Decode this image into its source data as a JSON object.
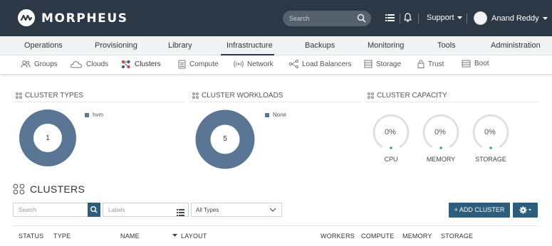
{
  "brand": {
    "name": "MORPHEUS"
  },
  "topbar": {
    "search_placeholder": "Search",
    "support_label": "Support",
    "user_name": "Anand Reddy",
    "icons": [
      "list-icon",
      "bell-icon",
      "search-icon",
      "caret-down-icon"
    ]
  },
  "main_nav": {
    "items": [
      "Operations",
      "Provisioning",
      "Library",
      "Infrastructure",
      "Backups",
      "Monitoring",
      "Tools",
      "Administration"
    ],
    "active": "Infrastructure"
  },
  "sub_nav": {
    "items": [
      "Groups",
      "Clouds",
      "Clusters",
      "Compute",
      "Network",
      "Load Balancers",
      "Storage",
      "Trust",
      "Boot"
    ],
    "active": "Clusters"
  },
  "widgets": {
    "cluster_types": {
      "title": "CLUSTER TYPES",
      "legend": "hvm",
      "center": "1"
    },
    "cluster_workloads": {
      "title": "CLUSTER WORKLOADS",
      "legend": "None",
      "center": "5"
    },
    "cluster_capacity": {
      "title": "CLUSTER CAPACITY",
      "gauges": [
        {
          "label": "CPU",
          "value": "0%"
        },
        {
          "label": "MEMORY",
          "value": "0%"
        },
        {
          "label": "STORAGE",
          "value": "0%"
        }
      ]
    }
  },
  "clusters": {
    "title": "CLUSTERS",
    "search_placeholder": "Search",
    "labels_placeholder": "Labels",
    "type_filter": "All Types",
    "add_button": "+ ADD CLUSTER",
    "columns": [
      "STATUS",
      "TYPE",
      "NAME",
      "LAYOUT",
      "WORKERS",
      "COMPUTE",
      "MEMORY",
      "STORAGE"
    ]
  },
  "colors": {
    "topbar": "#2c3846",
    "donut": "#5a7694",
    "primary_button": "#2d5d7b",
    "gauge_track": "#dde1e5",
    "gauge_dot": "#3aa76d"
  }
}
